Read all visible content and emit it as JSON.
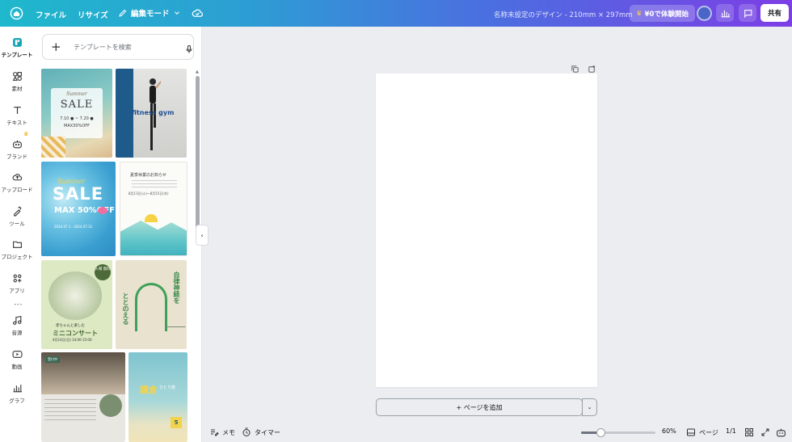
{
  "topbar": {
    "file_label": "ファイル",
    "resize_label": "リサイズ",
    "edit_mode_label": "編集モード",
    "doc_title": "名称未設定のデザイン - 210mm × 297mm",
    "trial_label": "¥0で体験開始",
    "share_label": "共有"
  },
  "rail": {
    "items": [
      {
        "label": "テンプレート",
        "icon": "template-icon"
      },
      {
        "label": "素材",
        "icon": "elements-icon"
      },
      {
        "label": "テキスト",
        "icon": "text-icon"
      },
      {
        "label": "ブランド",
        "icon": "brand-icon"
      },
      {
        "label": "アップロード",
        "icon": "upload-icon"
      },
      {
        "label": "ツール",
        "icon": "tools-icon"
      },
      {
        "label": "プロジェクト",
        "icon": "folder-icon"
      },
      {
        "label": "アプリ",
        "icon": "apps-icon"
      },
      {
        "label": "音源",
        "icon": "music-icon"
      },
      {
        "label": "動画",
        "icon": "video-icon"
      },
      {
        "label": "グラフ",
        "icon": "chart-icon"
      }
    ]
  },
  "panel": {
    "search_placeholder": "テンプレートを検索",
    "templates": {
      "t1": {
        "script": "Summer",
        "big": "SALE",
        "date": "7.10 ● ~ 7.20 ●",
        "off": "MAX30%OFF"
      },
      "t2": {
        "logo": "fitness gym"
      },
      "t3": {
        "summer": "Summer",
        "big": "SALE",
        "max": "MAX 50%OFF",
        "small": "2024.07.1 - 2024.07.31"
      },
      "t4": {
        "title": "夏季休業のお知らせ",
        "dates": "8月13日(火)～8月15日(木)"
      },
      "t5": {
        "badge": "入場 無料",
        "sub": "赤ちゃんと楽しむ",
        "title": "ミニコンサート",
        "info": "4月14日(日) 14:00-15:00"
      },
      "t6": {
        "v1": "自律神経を",
        "v2": "ととのえる"
      },
      "t7": {
        "tag": "受付中"
      },
      "t8": {
        "title": "鎌倉",
        "sub": "ひとり旅",
        "num": "5"
      }
    }
  },
  "canvas": {
    "add_page_label": "+ ページを追加"
  },
  "bottombar": {
    "memo_label": "メモ",
    "timer_label": "タイマー",
    "zoom_percent": 60,
    "zoom_label": "60%",
    "page_label": "ページ",
    "page_count": "1/1"
  }
}
